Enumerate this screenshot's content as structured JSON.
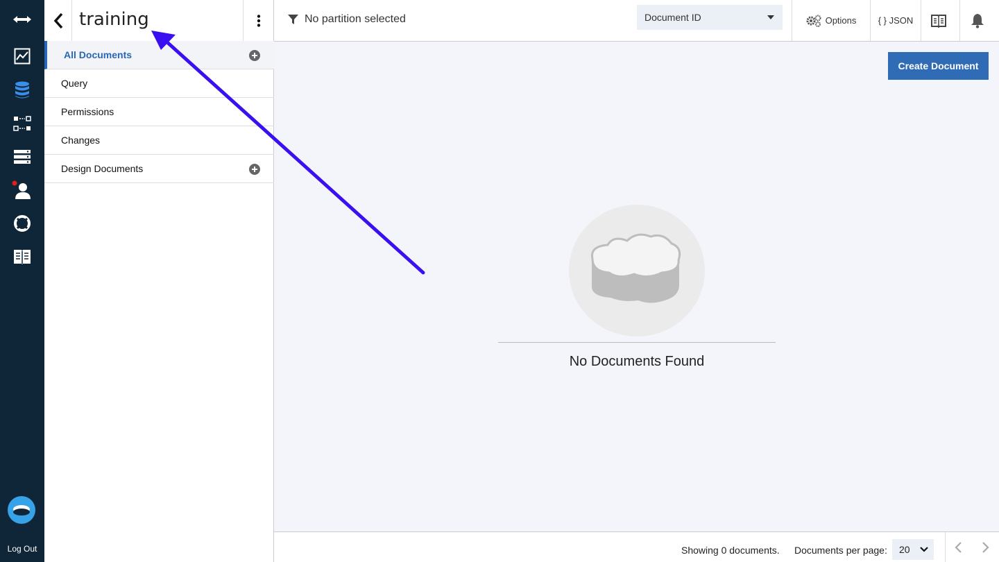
{
  "rail": {
    "icons": [
      "expand-arrows-icon",
      "activity-chart-icon",
      "database-icon",
      "replication-icon",
      "server-icon",
      "user-icon",
      "support-lifebuoy-icon",
      "docs-book-icon"
    ],
    "logout_label": "Log Out",
    "notification_dot_color": "#e0201b",
    "accent": "#3b8fe8"
  },
  "sidebar": {
    "title": "training",
    "items": [
      {
        "label": "All Documents",
        "active": true,
        "has_add": true
      },
      {
        "label": "Query",
        "active": false,
        "has_add": false
      },
      {
        "label": "Permissions",
        "active": false,
        "has_add": false
      },
      {
        "label": "Changes",
        "active": false,
        "has_add": false
      },
      {
        "label": "Design Documents",
        "active": false,
        "has_add": true
      }
    ]
  },
  "topbar": {
    "partition_label": "No partition selected",
    "select_value": "Document ID",
    "options_label": "Options",
    "json_label": "{ } JSON"
  },
  "main": {
    "create_label": "Create Document",
    "empty_message": "No Documents Found"
  },
  "footer": {
    "showing": "Showing 0 documents.",
    "per_page_label": "Documents per page:",
    "per_page_value": "20"
  },
  "colors": {
    "brand_blue": "#2f6cb5",
    "annotation_arrow": "#3a10f0"
  }
}
